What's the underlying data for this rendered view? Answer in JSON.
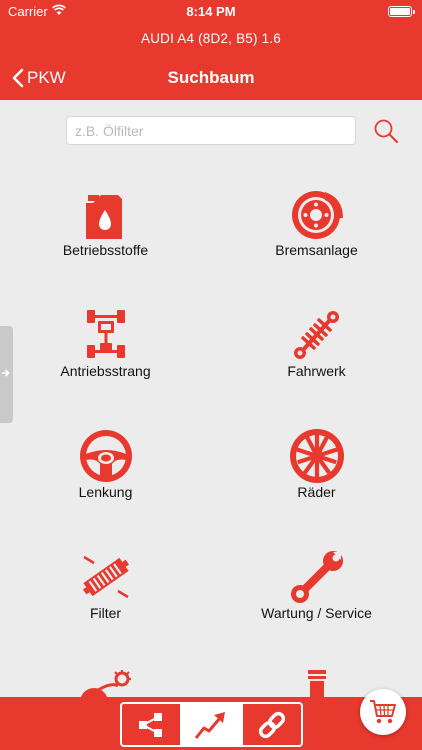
{
  "status_bar": {
    "carrier": "Carrier",
    "time": "8:14 PM"
  },
  "header": {
    "vehicle": "AUDI A4 (8D2, B5) 1.6",
    "back_label": "PKW",
    "title": "Suchbaum"
  },
  "search": {
    "placeholder": "z.B. Ölfilter",
    "value": ""
  },
  "categories": [
    {
      "label": "Betriebsstoffe",
      "icon": "oil-canister-icon"
    },
    {
      "label": "Bremsanlage",
      "icon": "brake-disc-icon"
    },
    {
      "label": "Antriebsstrang",
      "icon": "drivetrain-icon"
    },
    {
      "label": "Fahrwerk",
      "icon": "shock-absorber-icon"
    },
    {
      "label": "Lenkung",
      "icon": "steering-wheel-icon"
    },
    {
      "label": "Räder",
      "icon": "wheel-rim-icon"
    },
    {
      "label": "Filter",
      "icon": "filter-icon"
    },
    {
      "label": "Wartung / Service",
      "icon": "wrench-icon"
    },
    {
      "label": "",
      "icon": "belt-drive-icon"
    },
    {
      "label": "",
      "icon": "piston-icon"
    }
  ],
  "bottom_bar": {
    "segments": [
      {
        "icon": "tree-icon",
        "active": false
      },
      {
        "icon": "arrow-icon",
        "active": true
      },
      {
        "icon": "link-icon",
        "active": false
      }
    ],
    "cart_icon": "cart-icon"
  },
  "colors": {
    "accent": "#e8392e",
    "background": "#ececec",
    "handle": "#c9c9c9"
  }
}
